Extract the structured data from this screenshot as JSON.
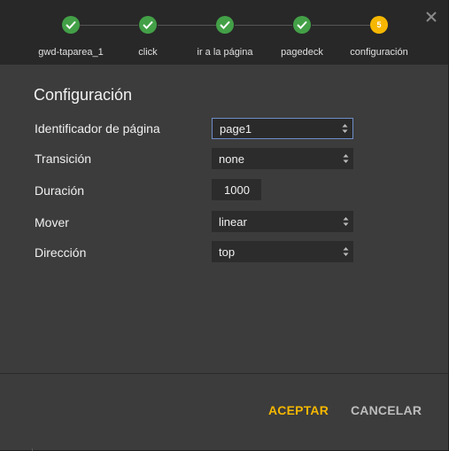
{
  "steps": [
    {
      "label": "gwd-taparea_1",
      "state": "done"
    },
    {
      "label": "click",
      "state": "done"
    },
    {
      "label": "ir a la página",
      "state": "done"
    },
    {
      "label": "pagedeck",
      "state": "done"
    },
    {
      "label": "configuración",
      "state": "current",
      "number": "5"
    }
  ],
  "title": "Configuración",
  "fields": {
    "page_id": {
      "label": "Identificador de página",
      "value": "page1"
    },
    "transition": {
      "label": "Transición",
      "value": "none"
    },
    "duration": {
      "label": "Duración",
      "value": "1000"
    },
    "easing": {
      "label": "Mover",
      "value": "linear"
    },
    "direction": {
      "label": "Dirección",
      "value": "top"
    }
  },
  "buttons": {
    "accept": "ACEPTAR",
    "cancel": "CANCELAR"
  },
  "colors": {
    "done": "#43a047",
    "current": "#f5b700",
    "accent": "#f5b700"
  },
  "icons": {
    "done": "check-icon",
    "close": "close-icon",
    "spinner": "spinner-arrows-icon"
  }
}
